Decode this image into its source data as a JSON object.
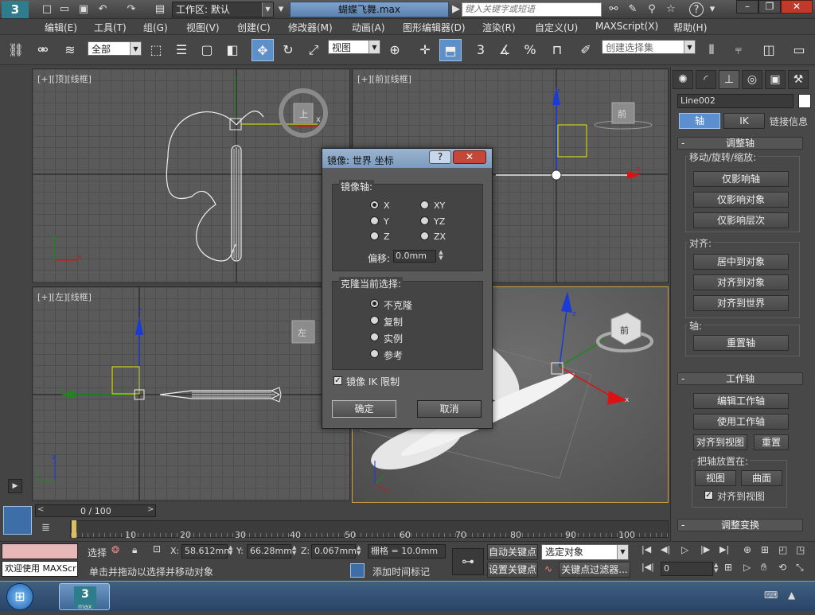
{
  "window": {
    "workspace_label": "工作区: 默认",
    "file_title": "蝴蝶飞舞.max",
    "search_placeholder": "键入关键字或短语"
  },
  "menu": [
    "编辑(E)",
    "工具(T)",
    "组(G)",
    "视图(V)",
    "创建(C)",
    "修改器(M)",
    "动画(A)",
    "图形编辑器(D)",
    "渲染(R)",
    "自定义(U)",
    "MAXScript(X)",
    "帮助(H)"
  ],
  "toolbar": {
    "selection_filter": "全部",
    "ref_coord": "视图",
    "selection_set_placeholder": "创建选择集",
    "snap_3": "3",
    "snap_pct": "%"
  },
  "viewports": {
    "top": "[+][顶][线框]",
    "front": "[+][前][线框]",
    "left": "[+][左][线框]",
    "top_cube": "上",
    "front_cube": "前",
    "left_cube": "左",
    "persp_cube": "前",
    "axis_x": "x",
    "axis_y": "y",
    "axis_z": "z"
  },
  "dialog": {
    "title": "镜像: 世界 坐标",
    "help": "?",
    "close": "✕",
    "mirror_axis_label": "镜像轴:",
    "axes": [
      {
        "label": "X",
        "selected": true
      },
      {
        "label": "XY",
        "selected": false
      },
      {
        "label": "Y",
        "selected": false
      },
      {
        "label": "YZ",
        "selected": false
      },
      {
        "label": "Z",
        "selected": false
      },
      {
        "label": "ZX",
        "selected": false
      }
    ],
    "offset_label": "偏移:",
    "offset_value": "0.0mm",
    "clone_label": "克隆当前选择:",
    "clone_options": [
      {
        "label": "不克隆",
        "selected": true
      },
      {
        "label": "复制",
        "selected": false
      },
      {
        "label": "实例",
        "selected": false
      },
      {
        "label": "参考",
        "selected": false
      }
    ],
    "mirror_ik_label": "镜像 IK 限制",
    "mirror_ik_checked": true,
    "ok": "确定",
    "cancel": "取消"
  },
  "command_panel": {
    "object_name": "Line002",
    "tab_pivot": "轴",
    "tab_ik": "IK",
    "tab_link": "链接信息",
    "rollout_adjust": "调整轴",
    "group_move": "移动/旋转/缩放:",
    "btn_affect_pivot": "仅影响轴",
    "btn_affect_object": "仅影响对象",
    "btn_affect_hierarchy": "仅影响层次",
    "group_align": "对齐:",
    "btn_center_object": "居中到对象",
    "btn_align_object": "对齐到对象",
    "btn_align_world": "对齐到世界",
    "group_pivot": "轴:",
    "btn_reset_pivot": "重置轴",
    "rollout_working": "工作轴",
    "btn_edit_working": "编辑工作轴",
    "btn_use_working": "使用工作轴",
    "btn_align_view": "对齐到视图",
    "btn_reset": "重置",
    "group_place": "把轴放置在:",
    "btn_view": "视图",
    "btn_surface": "曲面",
    "chk_align_view": "对齐到视图",
    "rollout_adjust_transform": "调整变换",
    "minus": "-"
  },
  "timeline": {
    "frame_label": "0 / 100",
    "ticks": [
      "10",
      "20",
      "30",
      "40",
      "50",
      "60",
      "70",
      "80",
      "90",
      "100"
    ]
  },
  "status": {
    "welcome": "欢迎使用  MAXScr",
    "select_label": "选择",
    "x_label": "X:",
    "x_value": "58.612mm",
    "y_label": "Y:",
    "y_value": "66.28mm",
    "z_label": "Z:",
    "z_value": "0.067mm",
    "grid": "栅格 = 10.0mm",
    "prompt": "单击并拖动以选择并移动对象",
    "add_time_tag": "添加时间标记",
    "auto_key": "自动关键点",
    "set_key": "设置关键点",
    "key_mode": "选定对象",
    "key_filters": "关键点过滤器...",
    "frame_value": "0"
  },
  "taskbar": {
    "app_label": "max"
  },
  "colors": {
    "accent_blue": "#5b8fcf",
    "dialog_title": "#8aa8c8",
    "viewport_bg": "#5a5a5a"
  }
}
